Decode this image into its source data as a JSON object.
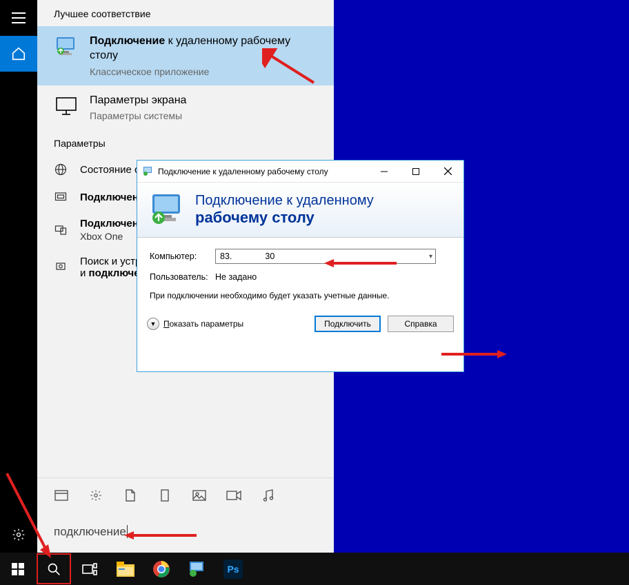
{
  "left_rail": {
    "menu": "≡",
    "home": "⌂",
    "settings": "⚙"
  },
  "search_panel": {
    "best_match_header": "Лучшее соответствие",
    "result1": {
      "title_bold": "Подключение",
      "title_rest": " к удаленному рабочему столу",
      "subtitle": "Классическое приложение"
    },
    "result2": {
      "title": "Параметры экрана",
      "subtitle": "Параметры системы"
    },
    "params_header": "Параметры",
    "param1": "Состояние сети",
    "param2": "Подключение",
    "param3_line1": "Подключение",
    "param3_rest": "Xbox One",
    "param4_pre": "Поиск и устранение",
    "param4_bold": "подключени",
    "search_text": "подключение"
  },
  "rdp": {
    "title": "Подключение к удаленному рабочему столу",
    "header_line1": "Подключение к удаленному",
    "header_line2": "рабочему столу",
    "computer_label": "Компьютер:",
    "computer_value_pre": "83.",
    "computer_value_post": "30",
    "user_label": "Пользователь:",
    "user_value": "Не задано",
    "note": "При подключении необходимо будет указать учетные данные.",
    "expand": "Показать параметры",
    "connect": "Подключить",
    "help": "Справка"
  },
  "taskbar": {
    "start": "⊞"
  }
}
